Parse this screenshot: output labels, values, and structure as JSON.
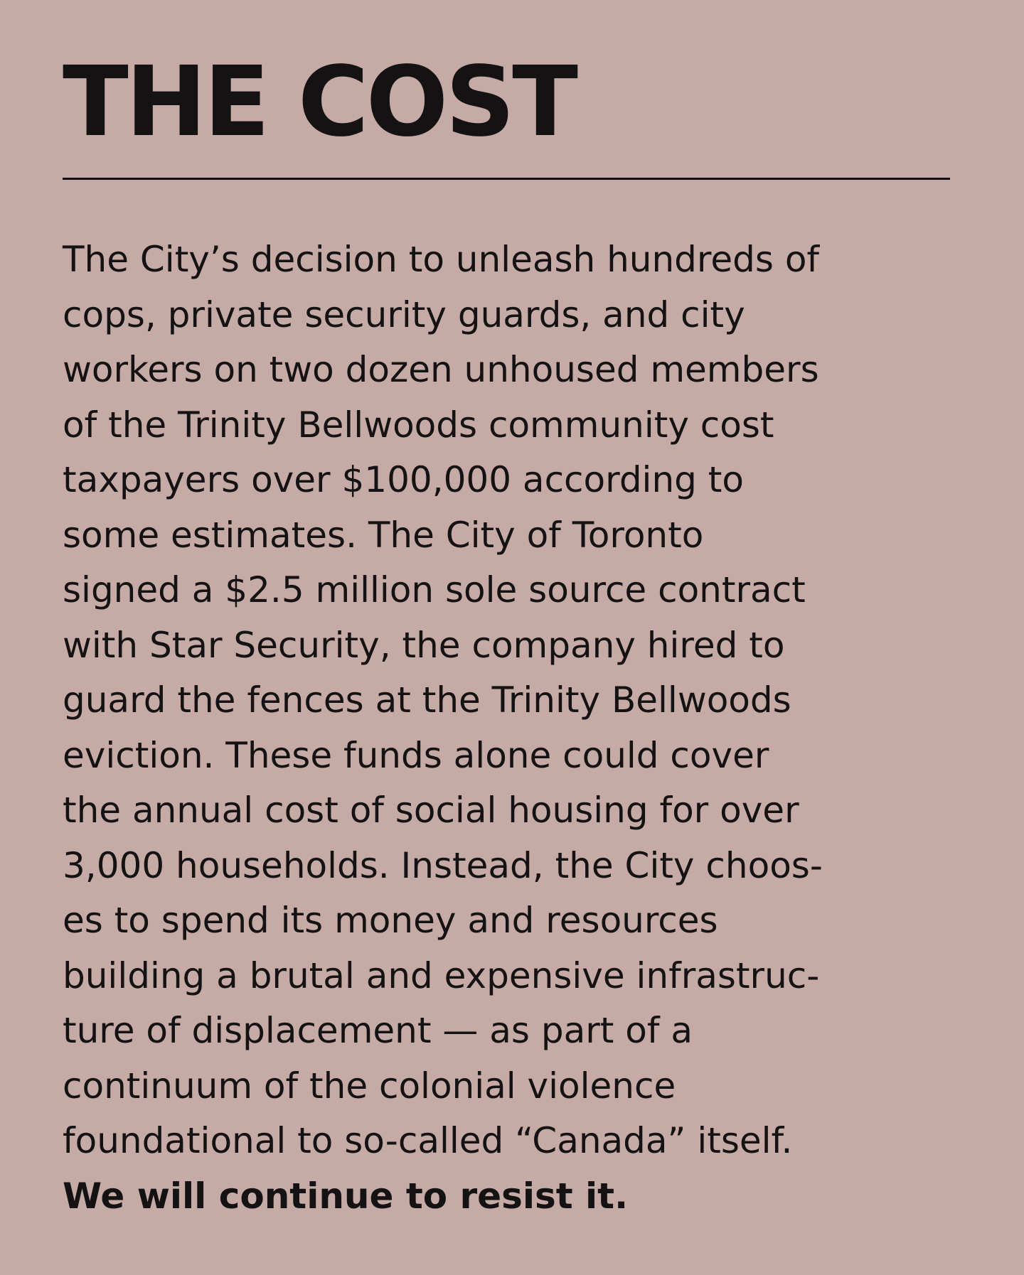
{
  "title": "THE COST",
  "body_lines": [
    "The City’s decision to unleash hundreds of",
    "cops, private security guards, and city",
    "workers on two dozen unhoused members",
    "of the Trinity Bellwoods community cost",
    "taxpayers over $100,000 according to",
    "some estimates. The City of Toronto",
    "signed a $2.5 million sole source contract",
    "with Star Security, the company hired to",
    "guard the fences at the Trinity Bellwoods",
    "eviction. These funds alone could cover",
    "the annual cost of social housing for over",
    "3,000 households. Instead, the City choos-",
    "es to spend its money and resources",
    "building a brutal and expensive infrastruc-",
    "ture of displacement — as part of a",
    "continuum of the colonial violence",
    "foundational to so-called “Canada” itself."
  ],
  "closing_line": "We will continue to resist it."
}
